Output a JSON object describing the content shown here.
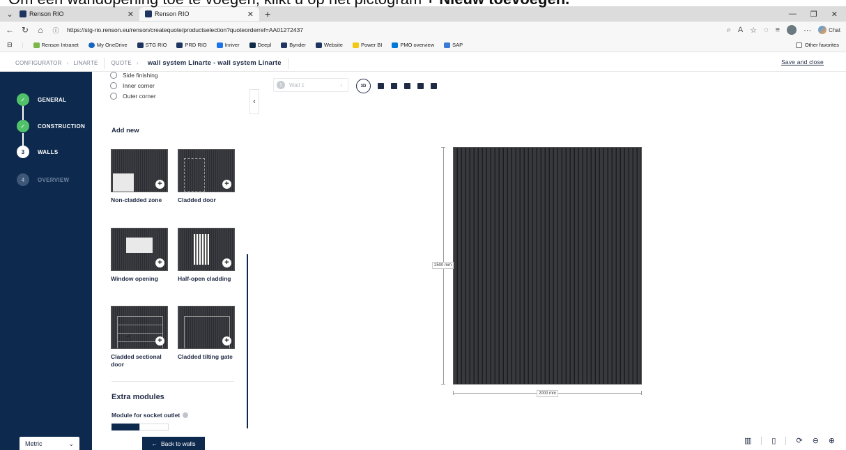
{
  "caption": {
    "prefix": "Om een wandopening toe te voegen, klikt u op het pictogram ",
    "bold": "+ Nieuw toevoegen."
  },
  "browser": {
    "tabs": [
      {
        "label": "Renson RIO"
      },
      {
        "label": "Renson RIO"
      }
    ],
    "url": "https://stg-rio.renson.eu/renson/createquote/productselection?quoteorderref=AA01272437",
    "chat_label": "Chat",
    "bookmarks": [
      {
        "label": "Renson Intranet",
        "color": "#7ab648"
      },
      {
        "label": "My OneDrive",
        "color": "#1565c0"
      },
      {
        "label": "STG RIO",
        "color": "#1d3560"
      },
      {
        "label": "PRD RIO",
        "color": "#1d3560"
      },
      {
        "label": "Inriver",
        "color": "#1a73e8"
      },
      {
        "label": "Deepl",
        "color": "#0f2b46"
      },
      {
        "label": "Bynder",
        "color": "#1d3560"
      },
      {
        "label": "Website",
        "color": "#1d3560"
      },
      {
        "label": "Power BI",
        "color": "#f2c811"
      },
      {
        "label": "PMO overview",
        "color": "#0078d4"
      },
      {
        "label": "SAP",
        "color": "#3a7bd5"
      }
    ],
    "other_favorites": "Other favorites"
  },
  "header": {
    "crumbs": [
      "CONFIGURATOR",
      "LINARTE"
    ],
    "quote": "QUOTE",
    "title": "wall system Linarte - wall system Linarte",
    "save": "Save and close"
  },
  "steps": [
    {
      "num": "✓",
      "label": "GENERAL",
      "state": "done"
    },
    {
      "num": "✓",
      "label": "CONSTRUCTION",
      "state": "done"
    },
    {
      "num": "3",
      "label": "WALLS",
      "state": "current"
    },
    {
      "num": "4",
      "label": "OVERVIEW",
      "state": "todo"
    }
  ],
  "unit": "Metric",
  "panel": {
    "radios": [
      "Side finishing",
      "Inner corner",
      "Outer corner"
    ],
    "add_new": "Add new",
    "options": [
      {
        "label": "Non-cladded zone"
      },
      {
        "label": "Cladded door"
      },
      {
        "label": "Window opening"
      },
      {
        "label": "Half-open cladding"
      },
      {
        "label": "Cladded sectional door"
      },
      {
        "label": "Cladded tilting gate"
      }
    ],
    "extra_modules": "Extra modules",
    "socket": "Module for socket outlet",
    "back": "Back to walls"
  },
  "canvas": {
    "wall_num": "1",
    "wall_name": "Wall 1",
    "view_3d": "3D",
    "height_label": "2500 mm",
    "width_label": "2000 mm"
  }
}
